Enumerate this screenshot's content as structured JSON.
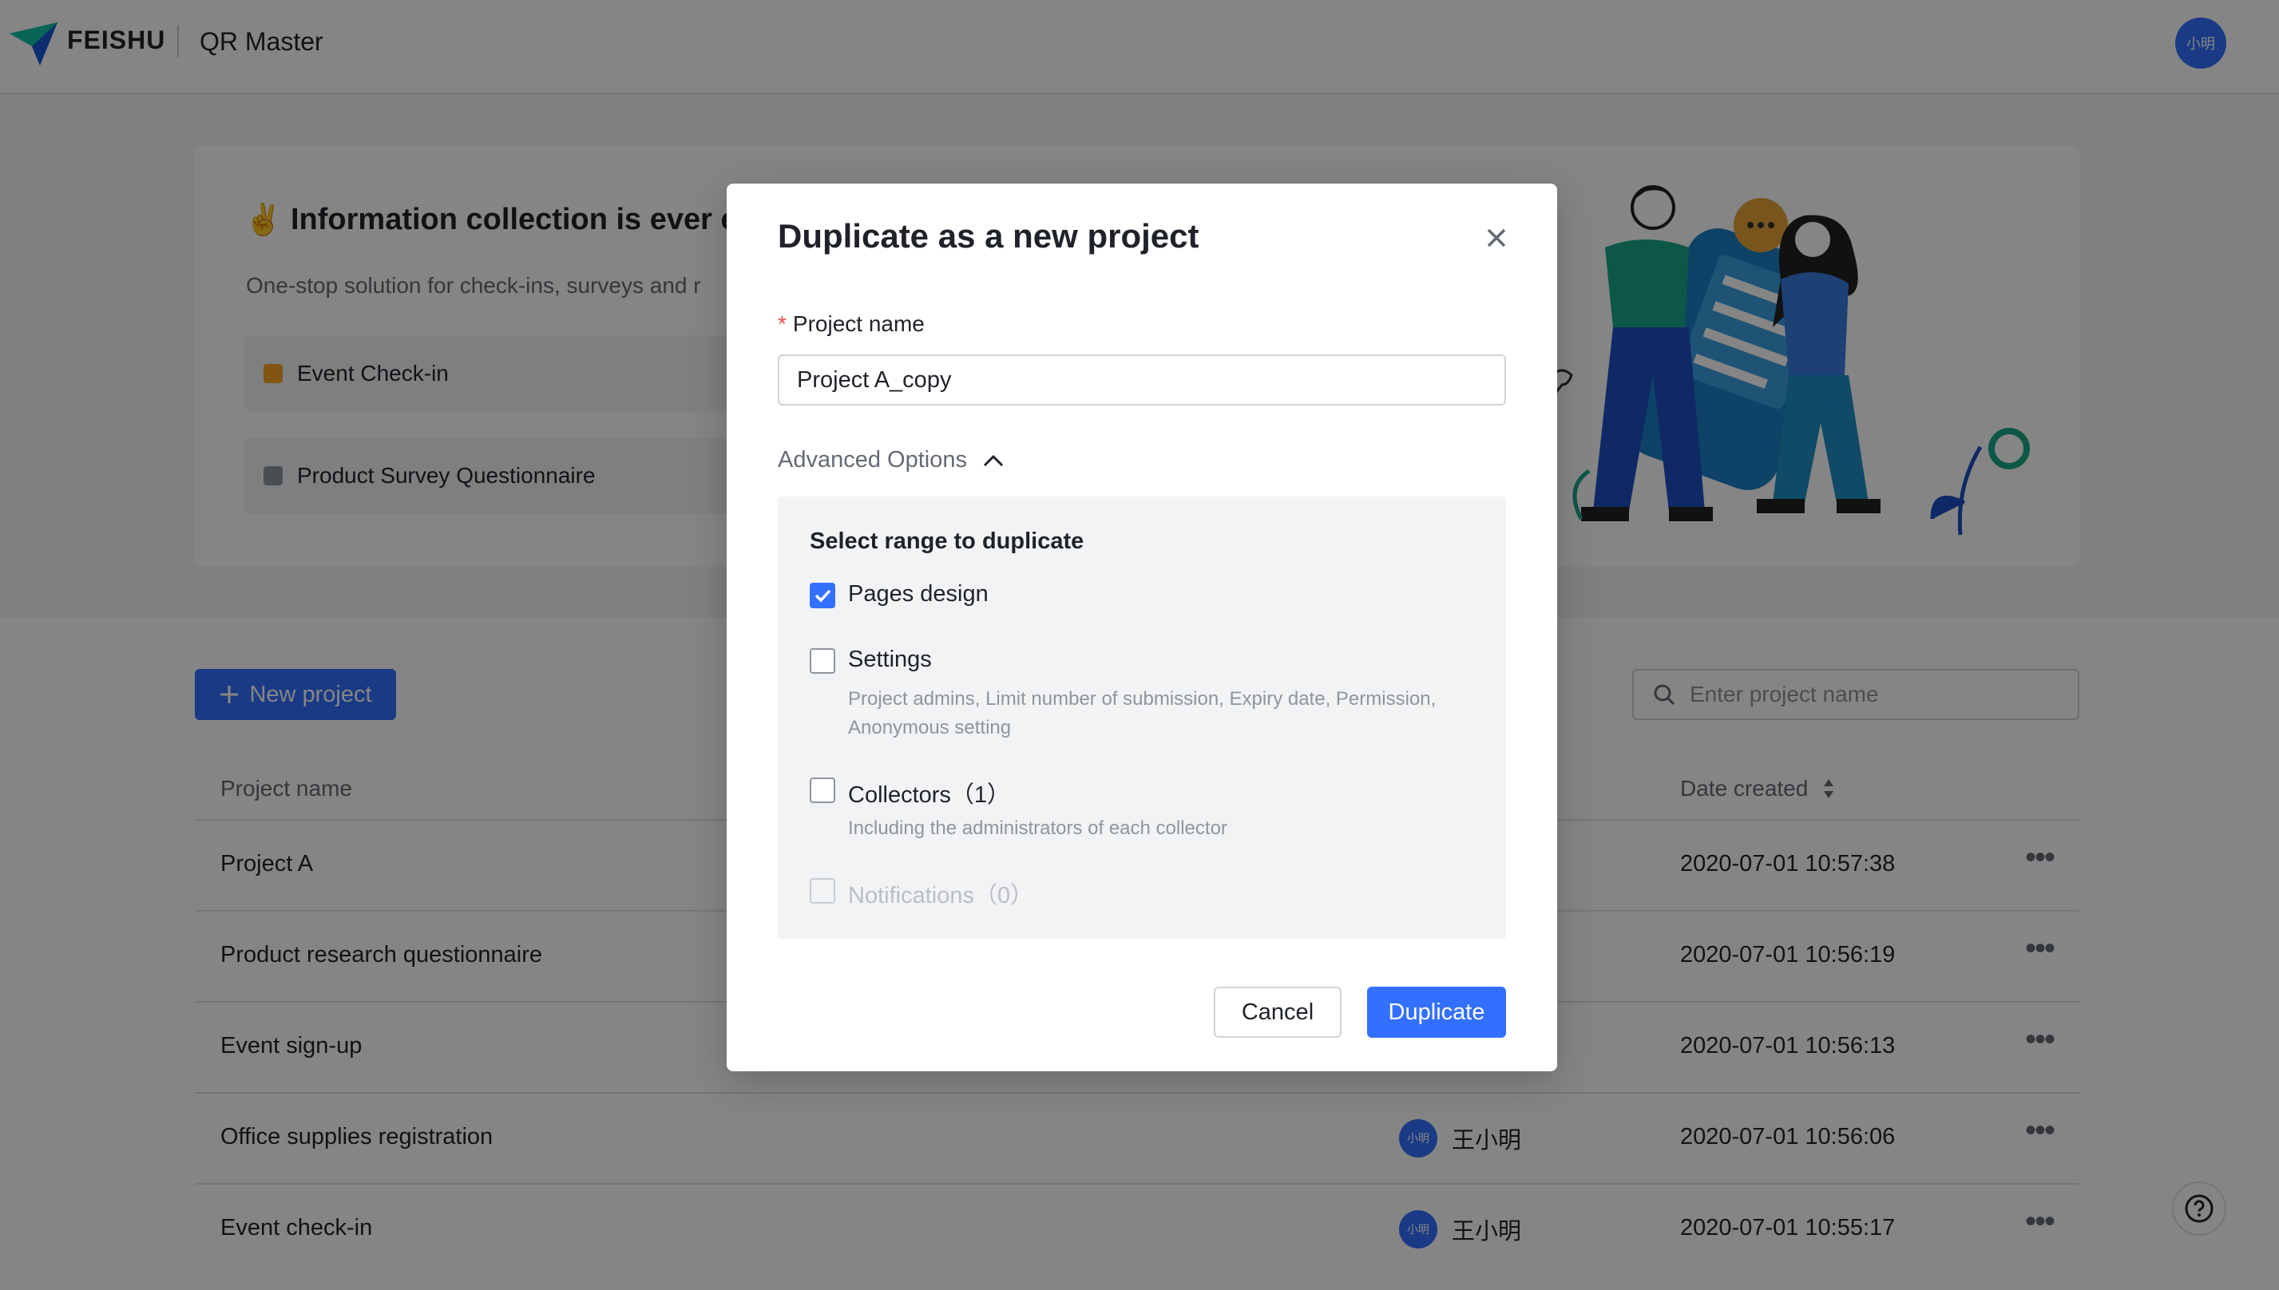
{
  "header": {
    "brand": "FEISHU",
    "app_title": "QR Master",
    "avatar_text": "小明"
  },
  "banner": {
    "emoji": "✌️",
    "heading": "Information collection is ever e",
    "subtitle": "One-stop solution for check-ins, surveys and r",
    "templates": [
      {
        "label": "Event Check-in",
        "icon": "check-in-icon",
        "color": "#f5a623"
      },
      {
        "label": "Product Survey Questionnaire",
        "icon": "survey-icon",
        "color": "#8f959e"
      }
    ]
  },
  "toolbar": {
    "new_project_label": "New project",
    "search_placeholder": "Enter project name"
  },
  "table": {
    "columns": {
      "name": "Project name",
      "date": "Date created"
    },
    "rows": [
      {
        "name": "Project A",
        "owner": "",
        "owner_avatar": "",
        "date": "2020-07-01 10:57:38"
      },
      {
        "name": "Product research questionnaire",
        "owner": "",
        "owner_avatar": "",
        "date": "2020-07-01 10:56:19"
      },
      {
        "name": "Event sign-up",
        "owner": "",
        "owner_avatar": "",
        "date": "2020-07-01 10:56:13"
      },
      {
        "name": "Office supplies registration",
        "owner": "王小明",
        "owner_avatar": "小明",
        "date": "2020-07-01 10:56:06"
      },
      {
        "name": "Event check-in",
        "owner": "王小明",
        "owner_avatar": "小明",
        "date": "2020-07-01 10:55:17"
      }
    ],
    "more_glyph": "•••"
  },
  "modal": {
    "title": "Duplicate as a new project",
    "name_label": "Project name",
    "required_mark": "*",
    "name_value": "Project A_copy",
    "advanced_label": "Advanced Options",
    "range_title": "Select range to duplicate",
    "options": [
      {
        "label": "Pages design",
        "description": "",
        "checked": true,
        "disabled": false
      },
      {
        "label": "Settings",
        "description": "Project admins, Limit number of submission, Expiry date, Permission, Anonymous setting",
        "checked": false,
        "disabled": false
      },
      {
        "label": "Collectors（1）",
        "description": "Including the administrators of each collector",
        "checked": false,
        "disabled": false
      },
      {
        "label": "Notifications（0）",
        "description": "",
        "checked": false,
        "disabled": true
      }
    ],
    "cancel_label": "Cancel",
    "confirm_label": "Duplicate"
  },
  "colors": {
    "primary": "#3370ff",
    "required": "#f54a45",
    "overlay": "rgba(0,0,0,0.48)"
  }
}
